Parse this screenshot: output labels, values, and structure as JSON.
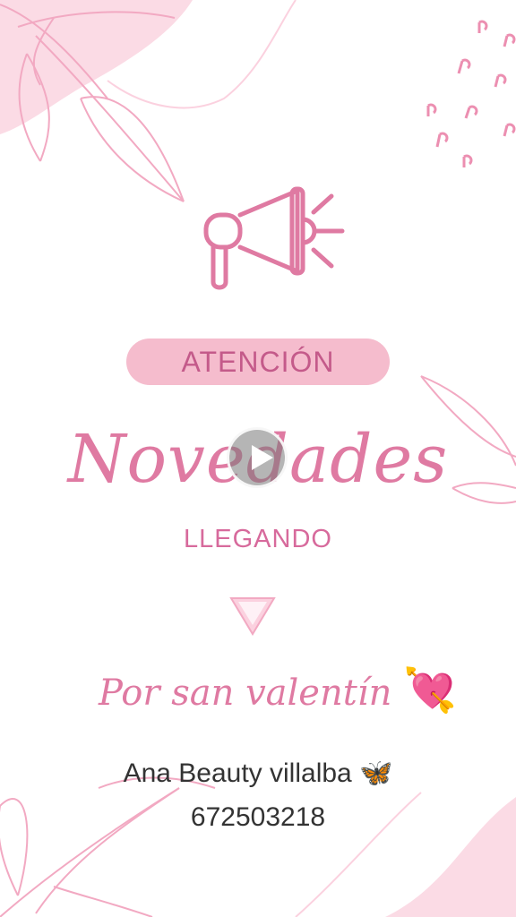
{
  "flyer": {
    "attention_label": "ATENCIÓN",
    "headline": "Novedades",
    "subheading": "LLEGANDO",
    "occasion": "Por san valentín",
    "occasion_emoji": "💘",
    "shop_name": "Ana Beauty villalba",
    "shop_emoji": "🦋",
    "phone": "672503218"
  },
  "icons": {
    "megaphone": "megaphone-icon",
    "down_arrow": "triangle-down-icon",
    "play": "play-icon",
    "heart_arrow": "heart-with-arrow-icon",
    "butterfly": "butterfly-icon"
  },
  "colors": {
    "accent_pink": "#df7aa2",
    "pill_pink": "#f5bccd",
    "pill_text": "#c45a8a",
    "text_dark": "#333333"
  }
}
